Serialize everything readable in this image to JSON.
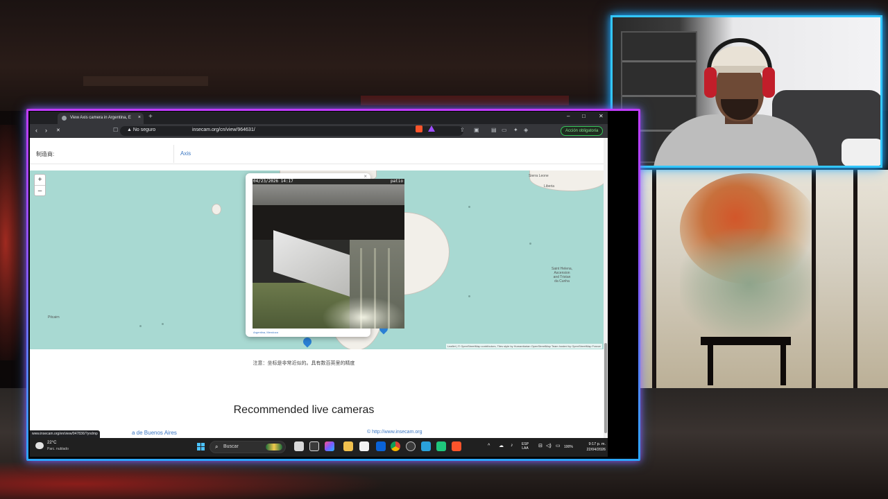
{
  "browser": {
    "tab_title": "View Axis camera in Argentina, E",
    "tab_close": "×",
    "new_tab": "+",
    "win_minimize": "–",
    "win_maximize": "□",
    "win_close": "✕",
    "back": "‹",
    "forward": "›",
    "reload": "✕",
    "security_label": "No seguro",
    "url": "insecam.org/cn/view/964631/",
    "accion_button": "Acción obligatoria"
  },
  "page": {
    "manufacturer_label": "制造商:",
    "manufacturer_value": "Axis",
    "zoom_in": "+",
    "zoom_out": "–",
    "coords_note": "注意：坐标是非常近似的。具有数百英里的精度",
    "recommended_title": "Recommended live cameras",
    "footer_link_partial": "a de Buenos Aires",
    "footer_copyright": "© http://www.insecam.org",
    "status_url": "www.insecam.org/en/view/947836/?yndmp"
  },
  "map": {
    "labels": {
      "pitcairn": "Pitcairn",
      "sierra_leone": "Sierra Leone",
      "liberia": "Liberia",
      "saint_helena": "Saint Helena,\nAscension\nand Tristan\nda Cunha"
    },
    "attribution": "Leaflet | © OpenStreetMap contributors, Tiles style by Humanitarian OpenStreetMap Team hosted by OpenStreetMap France",
    "popup": {
      "close": "×",
      "timestamp": "04/23/2026 14:17",
      "overlay_right": "patio",
      "caption": "Argentina, Mendoza"
    },
    "colors": {
      "sea": "#a8d9d2",
      "land": "#f2efe9",
      "marker": "#2a7fd4"
    }
  },
  "taskbar": {
    "weather_temp": "22°C",
    "weather_desc": "Parc. nublado",
    "search_placeholder": "Buscar",
    "lang_top": "ESP",
    "lang_bottom": "LAA",
    "battery": "100%",
    "time": "9:17 p. m.",
    "date": "22/04/2026"
  },
  "overlay": {
    "frame_colors": {
      "top": "#c23bff",
      "bottom": "#2ba6ff",
      "webcam": "#33c7ff"
    }
  }
}
